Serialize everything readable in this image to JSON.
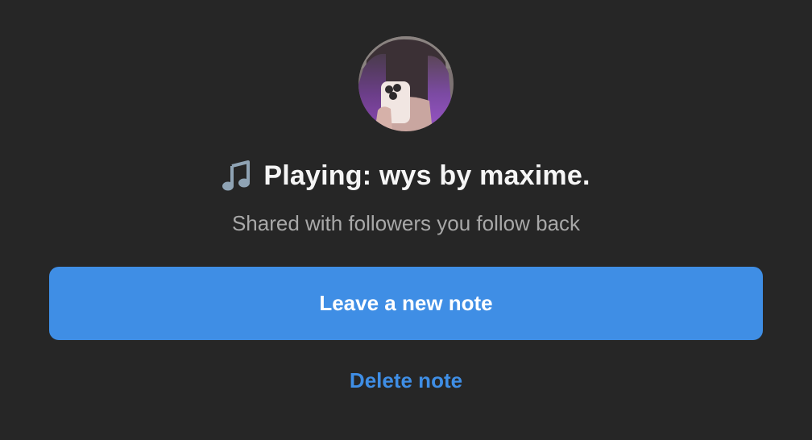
{
  "note": {
    "icon": "music-note-icon",
    "text": "Playing: wys by maxime.",
    "audience": "Shared with followers you follow back"
  },
  "actions": {
    "primary_label": "Leave a new note",
    "secondary_label": "Delete note"
  },
  "colors": {
    "background": "#262626",
    "accent": "#3f8ee5",
    "primary_text": "#f5f5f5",
    "secondary_text": "#a8a8a8"
  }
}
